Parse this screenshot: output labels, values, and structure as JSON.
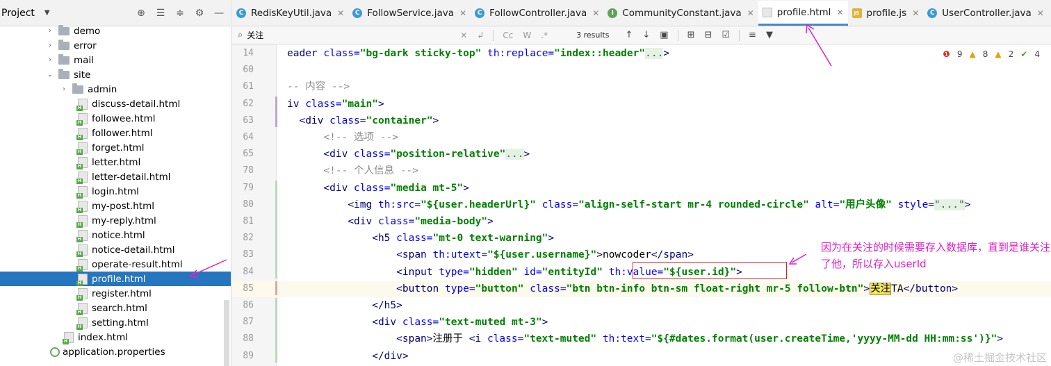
{
  "project_panel": {
    "title": "Project",
    "tree": [
      {
        "label": "demo",
        "type": "folder",
        "depth": 1,
        "expanded": false
      },
      {
        "label": "error",
        "type": "folder",
        "depth": 1,
        "expanded": false
      },
      {
        "label": "mail",
        "type": "folder",
        "depth": 1,
        "expanded": false
      },
      {
        "label": "site",
        "type": "folder",
        "depth": 1,
        "expanded": true
      },
      {
        "label": "admin",
        "type": "folder",
        "depth": 2,
        "expanded": false
      },
      {
        "label": "discuss-detail.html",
        "type": "html",
        "depth": 3
      },
      {
        "label": "followee.html",
        "type": "html",
        "depth": 3
      },
      {
        "label": "follower.html",
        "type": "html",
        "depth": 3
      },
      {
        "label": "forget.html",
        "type": "html",
        "depth": 3
      },
      {
        "label": "letter.html",
        "type": "html",
        "depth": 3
      },
      {
        "label": "letter-detail.html",
        "type": "html",
        "depth": 3
      },
      {
        "label": "login.html",
        "type": "html",
        "depth": 3
      },
      {
        "label": "my-post.html",
        "type": "html",
        "depth": 3
      },
      {
        "label": "my-reply.html",
        "type": "html",
        "depth": 3
      },
      {
        "label": "notice.html",
        "type": "html",
        "depth": 3
      },
      {
        "label": "notice-detail.html",
        "type": "html",
        "depth": 3
      },
      {
        "label": "operate-result.html",
        "type": "html",
        "depth": 3
      },
      {
        "label": "profile.html",
        "type": "html",
        "depth": 3,
        "selected": true
      },
      {
        "label": "register.html",
        "type": "html",
        "depth": 3
      },
      {
        "label": "search.html",
        "type": "html",
        "depth": 3
      },
      {
        "label": "setting.html",
        "type": "html",
        "depth": 3
      },
      {
        "label": "index.html",
        "type": "html",
        "depth": 2
      },
      {
        "label": "application.properties",
        "type": "prop",
        "depth": 1
      }
    ]
  },
  "tabs": [
    {
      "label": "RedisKeyUtil.java",
      "icon": "java-class-icon",
      "glyph": "C"
    },
    {
      "label": "FollowService.java",
      "icon": "java-class-icon",
      "glyph": "C"
    },
    {
      "label": "FollowController.java",
      "icon": "java-class-icon",
      "glyph": "C"
    },
    {
      "label": "CommunityConstant.java",
      "icon": "java-interface-icon",
      "glyph": "I"
    },
    {
      "label": "profile.html",
      "icon": "html-file-icon",
      "glyph": "",
      "active": true
    },
    {
      "label": "profile.js",
      "icon": "js-file-icon",
      "glyph": "JS"
    },
    {
      "label": "UserController.java",
      "icon": "java-class-icon",
      "glyph": "C"
    }
  ],
  "find": {
    "query": "关注",
    "results": "3 results",
    "match_case": "Cc",
    "words": "W",
    "regex": ".*"
  },
  "inspections": {
    "errors": "9",
    "warnings": "8",
    "weak": "2",
    "ok": "4"
  },
  "editor_lines": [
    {
      "n": "14"
    },
    {
      "n": "60"
    },
    {
      "n": "61"
    },
    {
      "n": "62"
    },
    {
      "n": "63"
    },
    {
      "n": "64"
    },
    {
      "n": "65"
    },
    {
      "n": "78"
    },
    {
      "n": "79"
    },
    {
      "n": "80"
    },
    {
      "n": "81"
    },
    {
      "n": "82"
    },
    {
      "n": "83"
    },
    {
      "n": "84"
    },
    {
      "n": "85"
    },
    {
      "n": "86"
    },
    {
      "n": "87"
    },
    {
      "n": "88"
    },
    {
      "n": "89"
    }
  ],
  "code": {
    "l14_a": "eader ",
    "l14_attr": "class=",
    "l14_v": "\"bg-dark sticky-top\"",
    "l14_attr2": " th:replace=",
    "l14_v2": "\"index::header\"",
    "l14_fold": "...",
    "l14_end": ">",
    "l61": "-- 内容 -->",
    "l62_tag": "iv ",
    "l62_attr": "class=",
    "l62_v": "\"main\"",
    "l62_end": ">",
    "l63_tag": "<div ",
    "l63_attr": "class=",
    "l63_v": "\"container\"",
    "l63_end": ">",
    "l64": "<!-- 选项 -->",
    "l65_tag": "<div ",
    "l65_attr": "class=",
    "l65_v": "\"position-relative\"",
    "l65_fold": "...",
    "l65_end": ">",
    "l78": "<!-- 个人信息 -->",
    "l79_tag": "<div ",
    "l79_attr": "class=",
    "l79_v": "\"media mt-5\"",
    "l79_end": ">",
    "l80_tag": "<img ",
    "l80_a1": "th:src=",
    "l80_v1": "\"${user.headerUrl}\"",
    "l80_a2": " class=",
    "l80_v2": "\"align-self-start mr-4 rounded-circle\"",
    "l80_a3": " alt=",
    "l80_v3": "\"用户头像\"",
    "l80_a4": " style=",
    "l80_v4": "\"...\"",
    "l80_end": ">",
    "l81_tag": "<div ",
    "l81_attr": "class=",
    "l81_v": "\"media-body\"",
    "l81_end": ">",
    "l82_tag": "<h5 ",
    "l82_attr": "class=",
    "l82_v": "\"mt-0 text-warning\"",
    "l82_end": ">",
    "l83_tag": "<span ",
    "l83_attr": "th:utext=",
    "l83_v": "\"${user.username}\"",
    "l83_txt": ">nowcoder",
    "l83_close": "</span>",
    "l84_tag": "<input ",
    "l84_a1": "type=",
    "l84_v1": "\"hidden\"",
    "l84_a2": " id=",
    "l84_v2": "\"entityId\"",
    "l84_a3": " th:value=",
    "l84_v3": "\"${user.id}\"",
    "l84_end": ">",
    "l85_tag": "<button ",
    "l85_a1": "type=",
    "l85_v1": "\"button\"",
    "l85_a2": " class=",
    "l85_v2": "\"btn btn-info btn-sm float-right mr-5 follow-btn\"",
    "l85_gt": ">",
    "l85_hl": "关注",
    "l85_txt": "TA",
    "l85_close": "</button>",
    "l86": "</h5>",
    "l87_tag": "<div ",
    "l87_attr": "class=",
    "l87_v": "\"text-muted mt-3\"",
    "l87_end": ">",
    "l88_tag": "<span>",
    "l88_txt": "注册于 ",
    "l88_tag2": "<i ",
    "l88_a1": "class=",
    "l88_v1": "\"text-muted\"",
    "l88_a2": " th:text=",
    "l88_v2": "\"${#dates.format(user.createTime,'yyyy-MM-dd HH:mm:ss')}\"",
    "l88_end": ">",
    "l89": "</div>"
  },
  "annotation": {
    "text": "因为在关注的时候需要存入数据库，直到是谁关注了他，所以存入userId",
    "color": "#e020c8"
  },
  "watermark": "@稀土掘金技术社区"
}
